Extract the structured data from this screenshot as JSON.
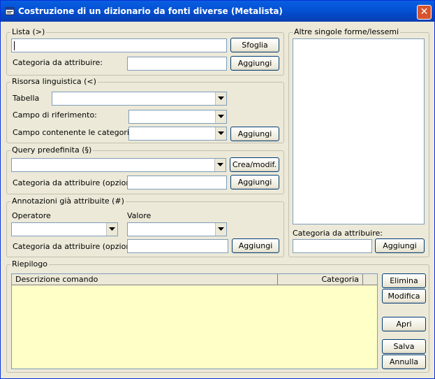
{
  "window": {
    "title": "Costruzione di un dizionario da fonti diverse (Metalista)"
  },
  "lista": {
    "title": "Lista (>)",
    "input_value": "",
    "browse_label": "Sfoglia",
    "category_label": "Categoria da attribuire:",
    "category_value": "",
    "add_label": "Aggiungi"
  },
  "risorsa": {
    "title": "Risorsa linguistica (<)",
    "table_label": "Tabella",
    "table_value": "",
    "ref_field_label": "Campo di riferimento:",
    "ref_field_value": "",
    "cat_field_label": "Campo contenente le categorie:",
    "cat_field_value": "",
    "add_label": "Aggiungi"
  },
  "query": {
    "title": "Query predefinita (§)",
    "query_value": "",
    "create_label": "Crea/modif.",
    "category_label": "Categoria da attribuire (opzionale):",
    "category_value": "",
    "add_label": "Aggiungi"
  },
  "annotazioni": {
    "title": "Annotazioni già attribuite (#)",
    "operator_label": "Operatore",
    "operator_value": "",
    "value_label": "Valore",
    "value_value": "",
    "category_label": "Categoria da attribuire (opzionale):",
    "category_value": "",
    "add_label": "Aggiungi"
  },
  "altre": {
    "title": "Altre singole forme/lessemi",
    "category_label": "Categoria da attribuire:",
    "category_value": "",
    "add_label": "Aggiungi"
  },
  "riepilogo": {
    "title": "Riepilogo",
    "columns": [
      "Descrizione comando",
      "Categoria"
    ],
    "rows": [],
    "buttons": {
      "delete": "Elimina",
      "edit": "Modifica",
      "open": "Apri",
      "save": "Salva",
      "cancel": "Annulla"
    }
  },
  "colors": {
    "title_bar": "#0453d6",
    "window_bg": "#ece9d8",
    "grid_bg": "#ffffc8",
    "close_button": "#d7542e"
  }
}
